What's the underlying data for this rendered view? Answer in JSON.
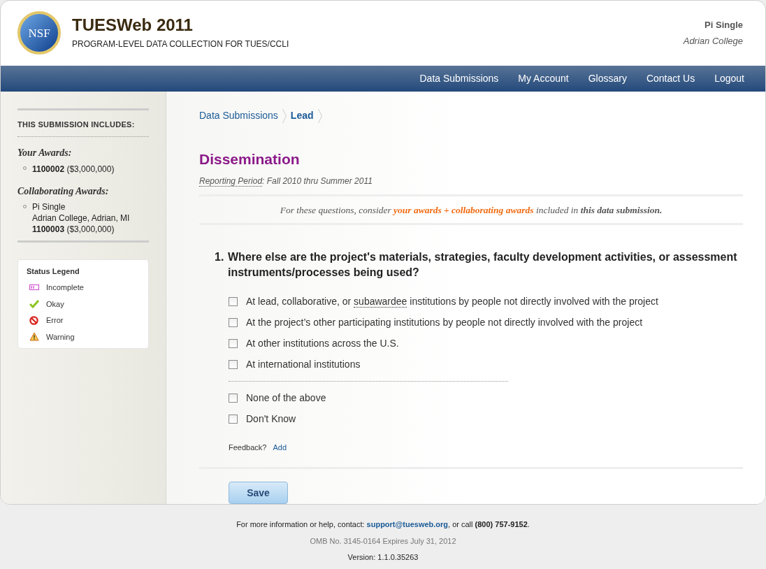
{
  "header": {
    "logo_text": "NSF",
    "title": "TUESWeb 2011",
    "subtitle": "PROGRAM-LEVEL DATA COLLECTION FOR TUES/CCLI",
    "user_name": "Pi Single",
    "user_org": "Adrian College"
  },
  "nav": [
    "Data Submissions",
    "My Account",
    "Glossary",
    "Contact Us",
    "Logout"
  ],
  "sidebar": {
    "heading": "THIS SUBMISSION INCLUDES:",
    "your_awards_title": "Your Awards:",
    "your_awards": [
      {
        "number": "1100002",
        "amount": "($3,000,000)"
      }
    ],
    "collaborating_title": "Collaborating Awards:",
    "collaborating_awards": [
      {
        "name": "Pi Single",
        "location": "Adrian College, Adrian, MI",
        "number": "1100003",
        "amount": "($3,000,000)"
      }
    ],
    "legend_title": "Status Legend",
    "legend": [
      {
        "kind": "incomplete",
        "label": "Incomplete"
      },
      {
        "kind": "okay",
        "label": "Okay"
      },
      {
        "kind": "error",
        "label": "Error"
      },
      {
        "kind": "warning",
        "label": "Warning"
      }
    ]
  },
  "breadcrumb": [
    {
      "label": "Data Submissions",
      "selected": false
    },
    {
      "label": "Lead",
      "selected": true
    }
  ],
  "page_title": "Dissemination",
  "reporting_period": {
    "label": "Reporting Period",
    "value": ": Fall 2010 thru Summer 2011"
  },
  "note": [
    {
      "kind": "plain",
      "text": "For these questions, consider "
    },
    {
      "kind": "highlight",
      "text": "your awards + collaborating awards"
    },
    {
      "kind": "plain",
      "text": " included in "
    },
    {
      "kind": "strong",
      "text": "this data submission."
    }
  ],
  "question": {
    "number": "1.",
    "text": "Where else are the project's materials, strategies, faculty development activities, or assessment instruments/processes being used?",
    "options": [
      {
        "checked": false,
        "segments": [
          {
            "text": "At lead, collaborative, or ",
            "term": false
          },
          {
            "text": "subawardee",
            "term": true
          },
          {
            "text": " institutions by people not directly involved with the project",
            "term": false
          }
        ]
      },
      {
        "checked": false,
        "segments": [
          {
            "text": "At the project’s other participating institutions by people not directly involved with the project",
            "term": false
          }
        ]
      },
      {
        "checked": false,
        "segments": [
          {
            "text": "At other institutions across the U.S.",
            "term": false
          }
        ]
      },
      {
        "checked": false,
        "segments": [
          {
            "text": "At international institutions",
            "term": false
          }
        ]
      }
    ],
    "extra_options": [
      {
        "checked": false,
        "label": "None of the above"
      },
      {
        "checked": false,
        "label": "Don't Know"
      }
    ],
    "feedback_label": "Feedback?",
    "feedback_link": "Add"
  },
  "save_button": "Save",
  "footer": {
    "contact_prefix": "For more information or help, contact: ",
    "email": "support@tuesweb.org",
    "contact_middle": ", or call ",
    "phone": "(800) 757-9152",
    "contact_end": ".",
    "omb": "OMB No. 3145-0164 Expires July 31, 2012",
    "version": "Version: 1.1.0.35263"
  }
}
